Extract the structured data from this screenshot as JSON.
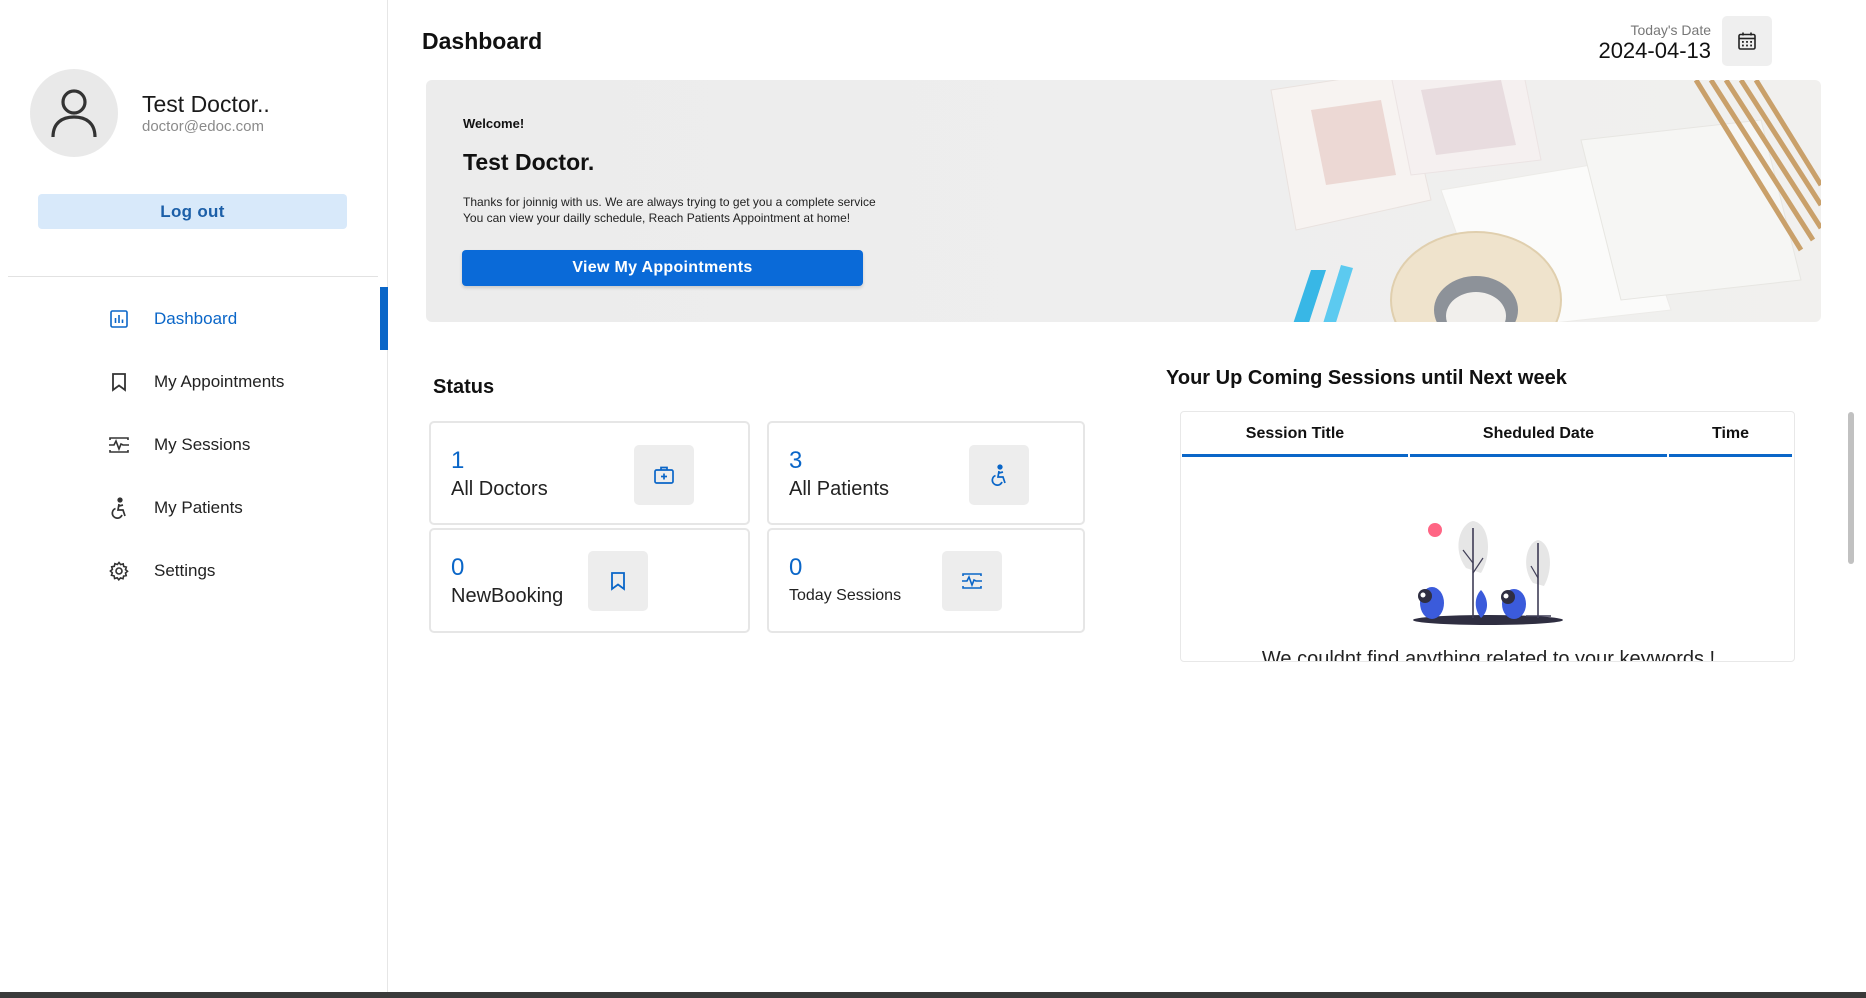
{
  "sidebar": {
    "profile": {
      "name": "Test Doctor..",
      "email": "doctor@edoc.com"
    },
    "logout_label": "Log out",
    "items": [
      {
        "label": "Dashboard",
        "icon": "chart-icon",
        "active": true
      },
      {
        "label": "My Appointments",
        "icon": "bookmark-icon",
        "active": false
      },
      {
        "label": "My Sessions",
        "icon": "sessions-icon",
        "active": false
      },
      {
        "label": "My Patients",
        "icon": "accessibility-icon",
        "active": false
      },
      {
        "label": "Settings",
        "icon": "gear-icon",
        "active": false
      }
    ]
  },
  "header": {
    "title": "Dashboard",
    "date_label": "Today's Date",
    "date_value": "2024-04-13"
  },
  "banner": {
    "welcome": "Welcome!",
    "name": "Test Doctor.",
    "line1": "Thanks for joinnig with us. We are always trying to get you a complete service",
    "line2": "You can view your dailly schedule, Reach Patients Appointment at home!",
    "button_label": "View My Appointments"
  },
  "status": {
    "title": "Status",
    "cards": [
      {
        "value": "1",
        "label": "All Doctors",
        "icon": "medical-bag-icon"
      },
      {
        "value": "3",
        "label": "All Patients",
        "icon": "accessibility-icon"
      },
      {
        "value": "0",
        "label": "NewBooking",
        "icon": "bookmark-icon"
      },
      {
        "value": "0",
        "label": "Today Sessions",
        "icon": "sessions-icon"
      }
    ]
  },
  "sessions": {
    "title": "Your Up Coming Sessions until Next week",
    "columns": [
      "Session Title",
      "Sheduled Date",
      "Time"
    ],
    "empty_message": "We couldnt find anything related to your keywords !"
  },
  "colors": {
    "accent": "#0a66c8",
    "button": "#0a6ad8",
    "logout_bg": "#d8e9fa"
  }
}
